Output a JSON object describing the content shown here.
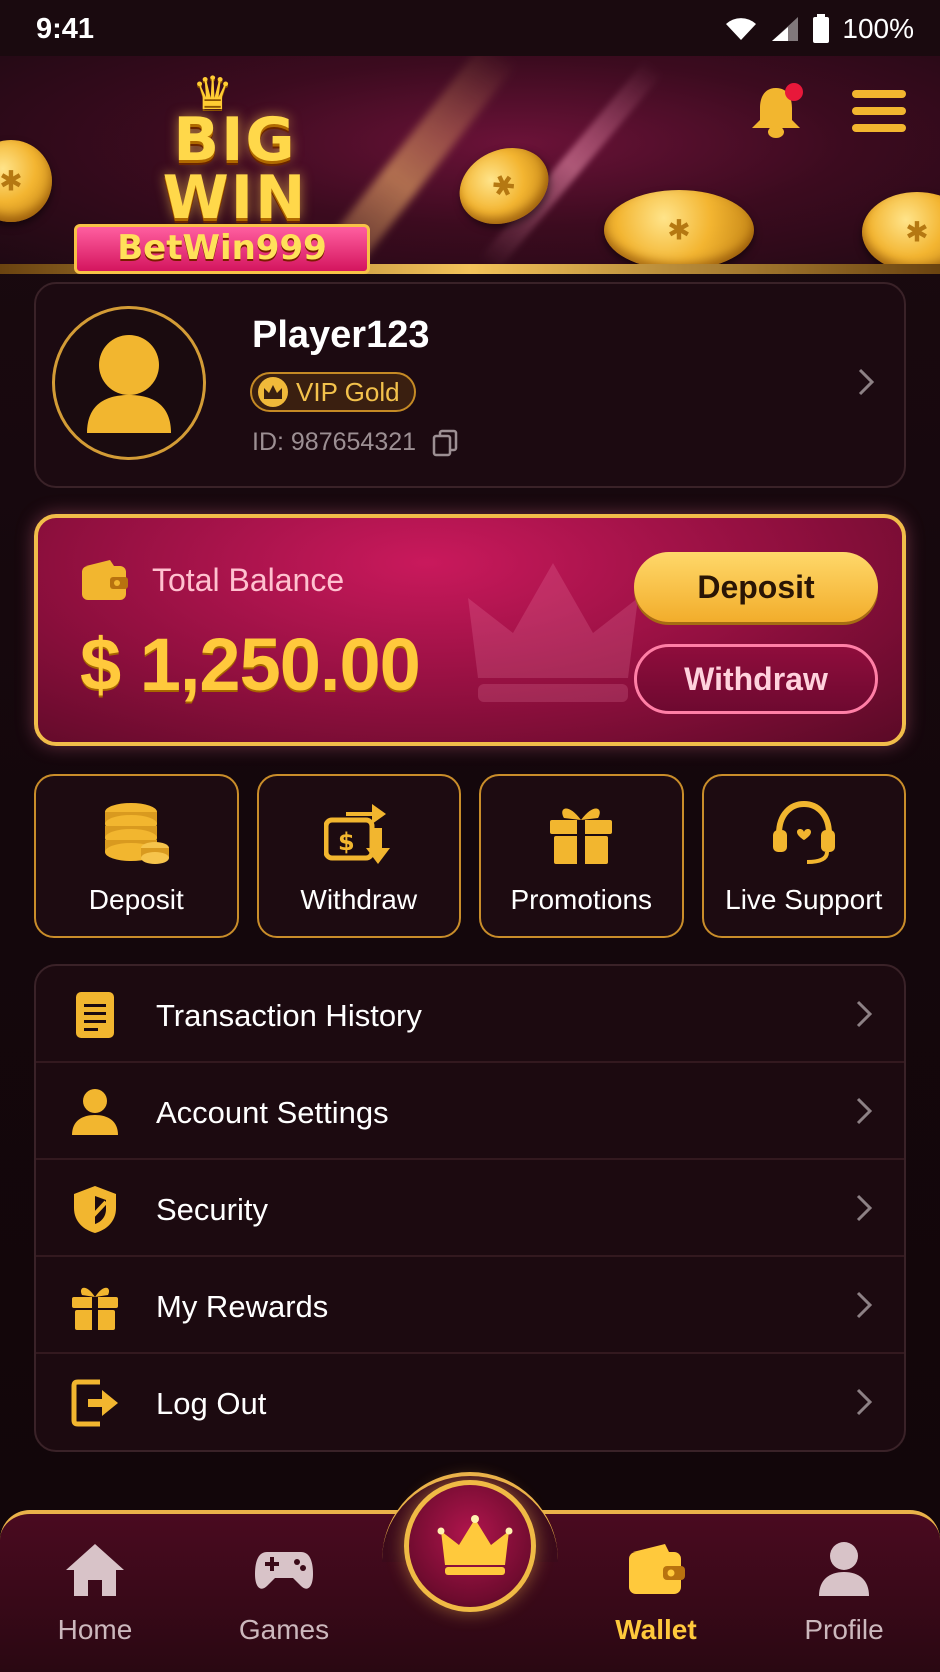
{
  "status_bar": {
    "time": "9:41",
    "battery": "100%"
  },
  "brand": {
    "big": "BIG",
    "win": "WIN",
    "name": "BetWin999"
  },
  "profile": {
    "username": "Player123",
    "vip_level": "VIP Gold",
    "id_text": "ID: 987654321"
  },
  "balance": {
    "label": "Total Balance",
    "amount": "$ 1,250.00",
    "deposit_label": "Deposit",
    "withdraw_label": "Withdraw"
  },
  "quick_actions": [
    {
      "label": "Deposit",
      "icon": "coins-stack-icon"
    },
    {
      "label": "Withdraw",
      "icon": "withdraw-wallet-icon"
    },
    {
      "label": "Promotions",
      "icon": "gift-icon"
    },
    {
      "label": "Live Support",
      "icon": "headset-icon"
    }
  ],
  "menu": [
    {
      "label": "Transaction History",
      "icon": "document-icon"
    },
    {
      "label": "Account Settings",
      "icon": "user-icon"
    },
    {
      "label": "Security",
      "icon": "shield-icon"
    },
    {
      "label": "My Rewards",
      "icon": "gift-icon"
    },
    {
      "label": "Log Out",
      "icon": "logout-icon"
    }
  ],
  "bottom_nav": [
    {
      "label": "Home",
      "icon": "home-icon",
      "active": false
    },
    {
      "label": "Games",
      "icon": "gamepad-icon",
      "active": false
    },
    {
      "label": "Wallet",
      "icon": "wallet-icon",
      "active": true
    },
    {
      "label": "Profile",
      "icon": "profile-icon",
      "active": false
    }
  ],
  "colors": {
    "gold": "#f2b62f",
    "magenta": "#c9195c",
    "background": "#14070c",
    "notification_dot": "#e8183a"
  }
}
